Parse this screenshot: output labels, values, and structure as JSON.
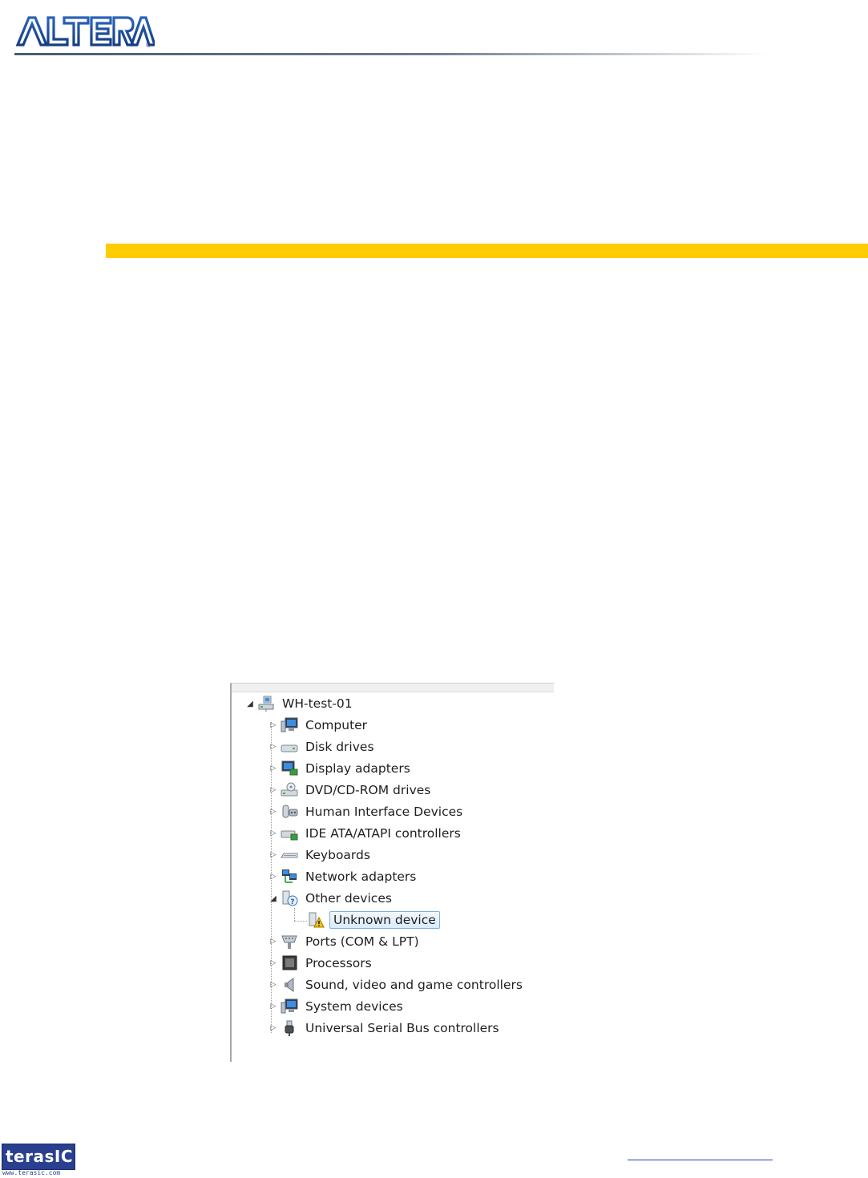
{
  "header": {
    "logo_text": "ALTERA",
    "registered_mark": "®"
  },
  "colors": {
    "accent_bar": "#ffcc00",
    "altera_blue": "#1d4e9e",
    "terasic_blue": "#2a3f8f",
    "selection_border": "#84acdd"
  },
  "device_manager": {
    "root": {
      "label": "WH-test-01",
      "icon": "computer-network-icon",
      "expanded": true
    },
    "categories": [
      {
        "label": "Computer",
        "icon": "computer-icon",
        "expanded": false
      },
      {
        "label": "Disk drives",
        "icon": "disk-drive-icon",
        "expanded": false
      },
      {
        "label": "Display adapters",
        "icon": "display-adapter-icon",
        "expanded": false
      },
      {
        "label": "DVD/CD-ROM drives",
        "icon": "dvd-drive-icon",
        "expanded": false
      },
      {
        "label": "Human Interface Devices",
        "icon": "hid-icon",
        "expanded": false
      },
      {
        "label": "IDE ATA/ATAPI controllers",
        "icon": "ide-controller-icon",
        "expanded": false
      },
      {
        "label": "Keyboards",
        "icon": "keyboard-icon",
        "expanded": false
      },
      {
        "label": "Network adapters",
        "icon": "network-adapter-icon",
        "expanded": false
      },
      {
        "label": "Other devices",
        "icon": "other-devices-icon",
        "expanded": true,
        "children": [
          {
            "label": "Unknown device",
            "icon": "unknown-device-warning-icon",
            "selected": true
          }
        ]
      },
      {
        "label": "Ports (COM & LPT)",
        "icon": "port-icon",
        "expanded": false
      },
      {
        "label": "Processors",
        "icon": "processor-icon",
        "expanded": false
      },
      {
        "label": "Sound, video and game controllers",
        "icon": "speaker-icon",
        "expanded": false
      },
      {
        "label": "System devices",
        "icon": "system-devices-icon",
        "expanded": false
      },
      {
        "label": "Universal Serial Bus controllers",
        "icon": "usb-icon",
        "expanded": false
      }
    ]
  },
  "footer": {
    "terasic_logo_text": "terasIC",
    "terasic_url": "www.terasic.com"
  }
}
